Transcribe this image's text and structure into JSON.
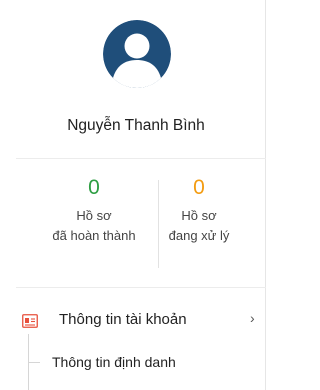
{
  "profile": {
    "avatar_icon": "user-avatar-icon",
    "name": "Nguyễn Thanh Bình"
  },
  "stats": [
    {
      "value": "0",
      "label_line1": "Hồ sơ",
      "label_line2": "đã hoàn thành",
      "color": "#2e9e43"
    },
    {
      "value": "0",
      "label_line1": "Hồ sơ",
      "label_line2": "đang xử lý",
      "color": "#f39c12"
    }
  ],
  "menu": {
    "account": {
      "icon": "id-card-icon",
      "label": "Thông tin tài khoản",
      "chevron": "›",
      "children": [
        {
          "label": "Thông tin định danh"
        }
      ]
    }
  },
  "colors": {
    "brand": "#1f4e7a",
    "accent_icon": "#e7503c",
    "completed": "#2e9e43",
    "in_progress": "#f39c12"
  }
}
